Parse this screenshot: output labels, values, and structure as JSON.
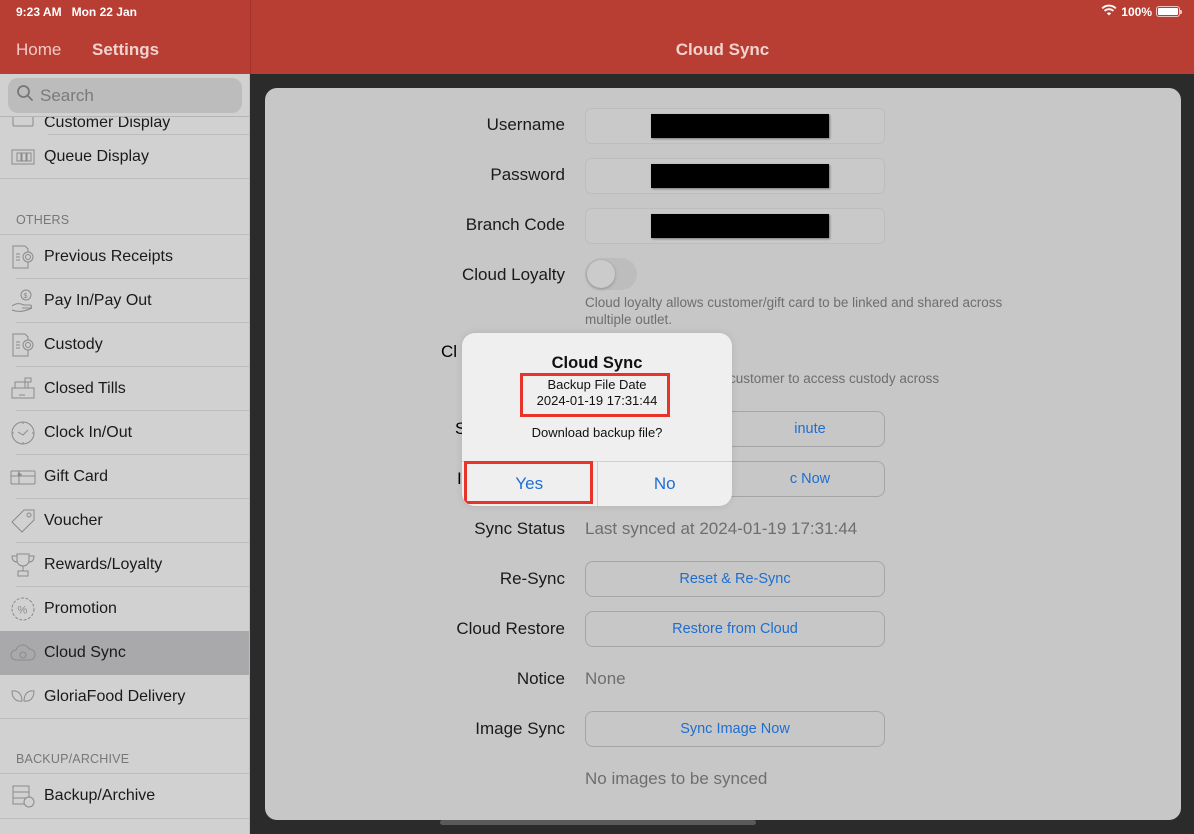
{
  "status_bar": {
    "time": "9:23 AM",
    "date": "Mon 22 Jan",
    "battery": "100%",
    "battery_level": 1.0
  },
  "nav": {
    "home": "Home",
    "settings": "Settings",
    "title": "Cloud Sync"
  },
  "sidebar": {
    "search_placeholder": "Search",
    "partial_item": "Customer Display",
    "items_top": [
      {
        "label": "Queue Display",
        "icon": "queue-display-icon"
      }
    ],
    "section_others": "OTHERS",
    "items_others": [
      {
        "label": "Previous Receipts",
        "icon": "receipt-icon"
      },
      {
        "label": "Pay In/Pay Out",
        "icon": "pay-in-out-icon"
      },
      {
        "label": "Custody",
        "icon": "custody-icon"
      },
      {
        "label": "Closed Tills",
        "icon": "cash-register-icon"
      },
      {
        "label": "Clock In/Out",
        "icon": "clock-icon"
      },
      {
        "label": "Gift Card",
        "icon": "gift-card-icon"
      },
      {
        "label": "Voucher",
        "icon": "tag-icon"
      },
      {
        "label": "Rewards/Loyalty",
        "icon": "trophy-icon"
      },
      {
        "label": "Promotion",
        "icon": "percent-badge-icon"
      },
      {
        "label": "Cloud Sync",
        "icon": "cloud-icon",
        "selected": true
      },
      {
        "label": "GloriaFood Delivery",
        "icon": "leaf-icon"
      }
    ],
    "section_backup": "BACKUP/ARCHIVE",
    "items_backup": [
      {
        "label": "Backup/Archive",
        "icon": "server-icon"
      }
    ]
  },
  "form": {
    "username_label": "Username",
    "password_label": "Password",
    "branch_code_label": "Branch Code",
    "cloud_loyalty_label": "Cloud Loyalty",
    "cloud_loyalty_on": false,
    "cloud_loyalty_hint": "Cloud loyalty allows customer/gift card to be linked and shared across multiple outlet.",
    "cloud_custody_label_partial": "Cl",
    "cloud_custody_hint_partial": "customer to access custody across",
    "sync_interval_label_partial": "S",
    "sync_interval_button_partial": "inute",
    "manual_sync_label_partial": "I",
    "manual_sync_button_partial": "c Now",
    "sync_status_label": "Sync Status",
    "sync_status_value": "Last synced at 2024-01-19 17:31:44",
    "resync_label": "Re-Sync",
    "resync_button": "Reset & Re-Sync",
    "cloud_restore_label": "Cloud Restore",
    "cloud_restore_button": "Restore from Cloud",
    "notice_label": "Notice",
    "notice_value": "None",
    "image_sync_label": "Image Sync",
    "image_sync_button": "Sync Image Now",
    "image_sync_status": "No images to be synced"
  },
  "dialog": {
    "title": "Cloud Sync",
    "line1": "Backup File Date",
    "line2": "2024-01-19 17:31:44",
    "question": "Download backup file?",
    "yes": "Yes",
    "no": "No",
    "highlight_color": "#e8332a"
  },
  "colors": {
    "brand": "#b83d32",
    "link": "#1f6ed0"
  }
}
